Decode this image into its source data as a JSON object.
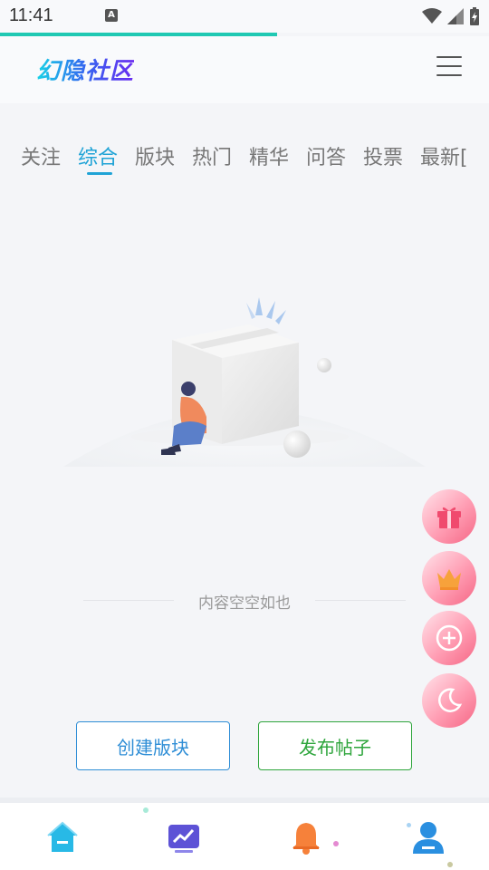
{
  "status": {
    "time": "11:41",
    "notif_icon": "A"
  },
  "header": {
    "logo": "幻隐社区",
    "menu_icon": "hamburger-menu-icon"
  },
  "tabs": [
    {
      "label": "关注",
      "active": false
    },
    {
      "label": "综合",
      "active": true
    },
    {
      "label": "版块",
      "active": false
    },
    {
      "label": "热门",
      "active": false
    },
    {
      "label": "精华",
      "active": false
    },
    {
      "label": "问答",
      "active": false
    },
    {
      "label": "投票",
      "active": false
    },
    {
      "label": "最新[",
      "active": false
    }
  ],
  "empty": {
    "text": "内容空空如也"
  },
  "buttons": {
    "create": "创建版块",
    "post": "发布帖子"
  },
  "fabs": [
    "gift-icon",
    "crown-icon",
    "plus-circle-icon",
    "moon-icon"
  ],
  "bottom_nav": [
    "home-icon",
    "chart-icon",
    "bell-icon",
    "user-icon"
  ],
  "colors": {
    "accent": "#1fa3d6",
    "create": "#2f8ed6",
    "post": "#2ea53c",
    "fab": "#f56785"
  }
}
